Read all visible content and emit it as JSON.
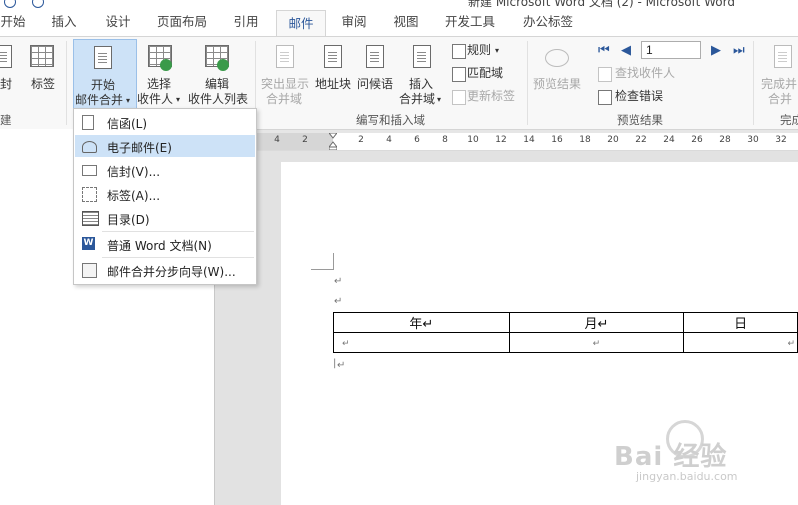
{
  "window": {
    "title": "新建 Microsoft Word 文档 (2) - Microsoft Word"
  },
  "tabs": [
    {
      "label": "开始"
    },
    {
      "label": "插入"
    },
    {
      "label": "设计"
    },
    {
      "label": "页面布局"
    },
    {
      "label": "引用"
    },
    {
      "label": "邮件"
    },
    {
      "label": "审阅"
    },
    {
      "label": "视图"
    },
    {
      "label": "开发工具"
    },
    {
      "label": "办公标签"
    }
  ],
  "ribbon": {
    "create": {
      "envelope_label": "封",
      "labels_label": "标签",
      "group_label": "建"
    },
    "start_merge": {
      "start_label": "开始",
      "start_label2": "邮件合并",
      "select_label": "选择",
      "select_label2": "收件人",
      "edit_label": "编辑",
      "edit_label2": "收件人列表"
    },
    "write_insert": {
      "highlight_label": "突出显示",
      "highlight_label2": "合并域",
      "address_label": "地址块",
      "greeting_label": "问候语",
      "insert_label": "插入",
      "insert_label2": "合并域",
      "rules_label": "规则",
      "match_label": "匹配域",
      "update_label": "更新标签",
      "group_label": "编写和插入域"
    },
    "preview": {
      "preview_label": "预览结果",
      "page_value": "1",
      "find_label": "查找收件人",
      "check_label": "检查错误",
      "group_label": "预览结果"
    },
    "finish": {
      "finish_label": "完成并",
      "finish_label2": "合并",
      "group_label": "完成"
    }
  },
  "ruler": {
    "ticks": [
      "4",
      "2",
      "2",
      "4",
      "6",
      "8",
      "10",
      "12",
      "14",
      "16",
      "18",
      "20",
      "22",
      "24",
      "26",
      "28",
      "30",
      "32"
    ]
  },
  "menu": {
    "items": [
      {
        "label": "信函(L)"
      },
      {
        "label": "电子邮件(E)"
      },
      {
        "label": "信封(V)..."
      },
      {
        "label": "标签(A)..."
      },
      {
        "label": "目录(D)"
      },
      {
        "label": "普通 Word 文档(N)"
      },
      {
        "label": "邮件合并分步向导(W)..."
      }
    ]
  },
  "document": {
    "paragraph_mark": "↵",
    "table": {
      "header": [
        "年↵",
        "月↵",
        "日"
      ],
      "row": [
        "↵",
        "↵",
        "↵"
      ]
    }
  },
  "watermark": {
    "brand": "Bai  经验",
    "url": "jingyan.baidu.com"
  }
}
